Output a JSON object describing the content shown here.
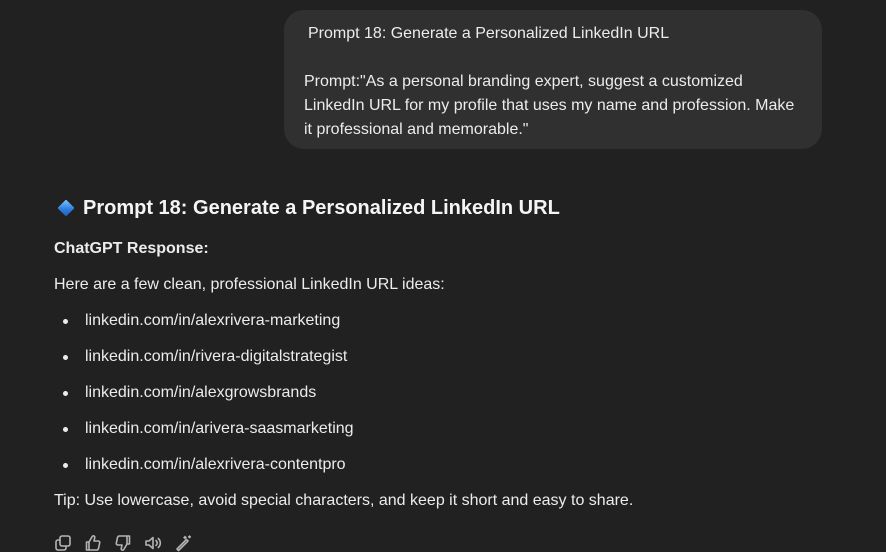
{
  "user_message": {
    "title": "Prompt 18: Generate a Personalized LinkedIn URL",
    "body": "Prompt:\"As a personal branding expert, suggest a customized LinkedIn URL for my profile that uses my name and profession. Make it professional and memorable.\""
  },
  "response": {
    "heading_icon": "blue-diamond-icon",
    "heading": "Prompt 18: Generate a Personalized LinkedIn URL",
    "label": "ChatGPT Response:",
    "intro": "Here are a few clean, professional LinkedIn URL ideas:",
    "urls": [
      "linkedin.com/in/alexrivera-marketing",
      "linkedin.com/in/rivera-digitalstrategist",
      "linkedin.com/in/alexgrowsbrands",
      "linkedin.com/in/arivera-saasmarketing",
      "linkedin.com/in/alexrivera-contentpro"
    ],
    "tip": "Tip: Use lowercase, avoid special characters, and keep it short and easy to share."
  },
  "actions": [
    {
      "icon": "copy-icon"
    },
    {
      "icon": "thumbs-up-icon"
    },
    {
      "icon": "thumbs-down-icon"
    },
    {
      "icon": "read-aloud-icon"
    },
    {
      "icon": "edit-wand-icon"
    }
  ],
  "colors": {
    "background": "#212121",
    "bubble": "#303030",
    "text": "#ececec",
    "icon": "#b4b4b4",
    "accent": "#2f7fe0"
  }
}
